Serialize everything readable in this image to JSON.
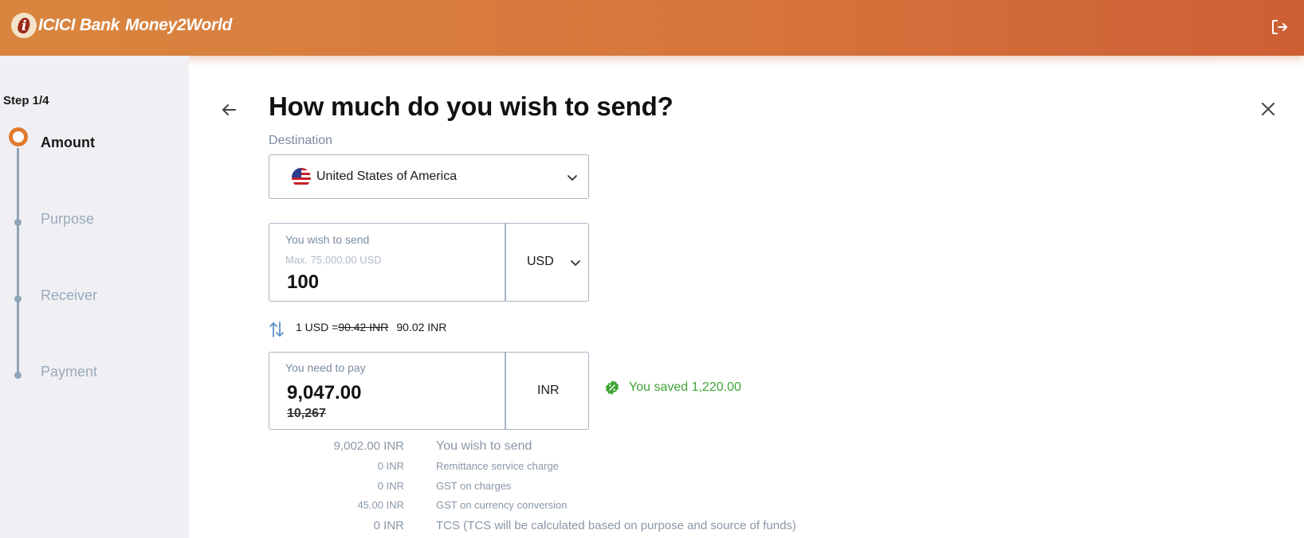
{
  "header": {
    "brand_icici": "ICICI Bank",
    "brand_m2w": "Money2World",
    "colors": {
      "gradient_start": "#d9853f",
      "gradient_end": "#cd5f35"
    },
    "logout_icon": "logout-icon"
  },
  "sidebar": {
    "step_count": "Step 1/4",
    "steps": [
      {
        "label": "Amount",
        "active": true
      },
      {
        "label": "Purpose",
        "active": false
      },
      {
        "label": "Receiver",
        "active": false
      },
      {
        "label": "Payment",
        "active": false
      }
    ],
    "accent": "#e07a2e"
  },
  "main": {
    "title": "How much do you wish to send?",
    "destination": {
      "label": "Destination",
      "value": "United States of America",
      "flag_icon": "us-flag-icon"
    },
    "send": {
      "label": "You wish to send",
      "hint": "Max. 75,000.00 USD",
      "value": "100",
      "currency": "USD"
    },
    "rate": {
      "prefix": "1 USD =",
      "old_rate": "90.42 INR",
      "new_rate": "90.02 INR"
    },
    "pay": {
      "label": "You need to pay",
      "value": "9,047.00",
      "old_value": "10,267",
      "currency": "INR"
    },
    "saved": {
      "text": "You saved 1,220.00",
      "color": "#3fa535"
    },
    "breakdown": [
      {
        "amount": "9,002.00 INR",
        "desc": "You wish to send"
      },
      {
        "amount": "0 INR",
        "desc": "Remittance service charge"
      },
      {
        "amount": "0 INR",
        "desc": "GST on charges"
      },
      {
        "amount": "45.00 INR",
        "desc": "GST on currency conversion"
      },
      {
        "amount": "0 INR",
        "desc": "TCS (TCS will be calculated based on purpose and source of funds)"
      }
    ]
  }
}
